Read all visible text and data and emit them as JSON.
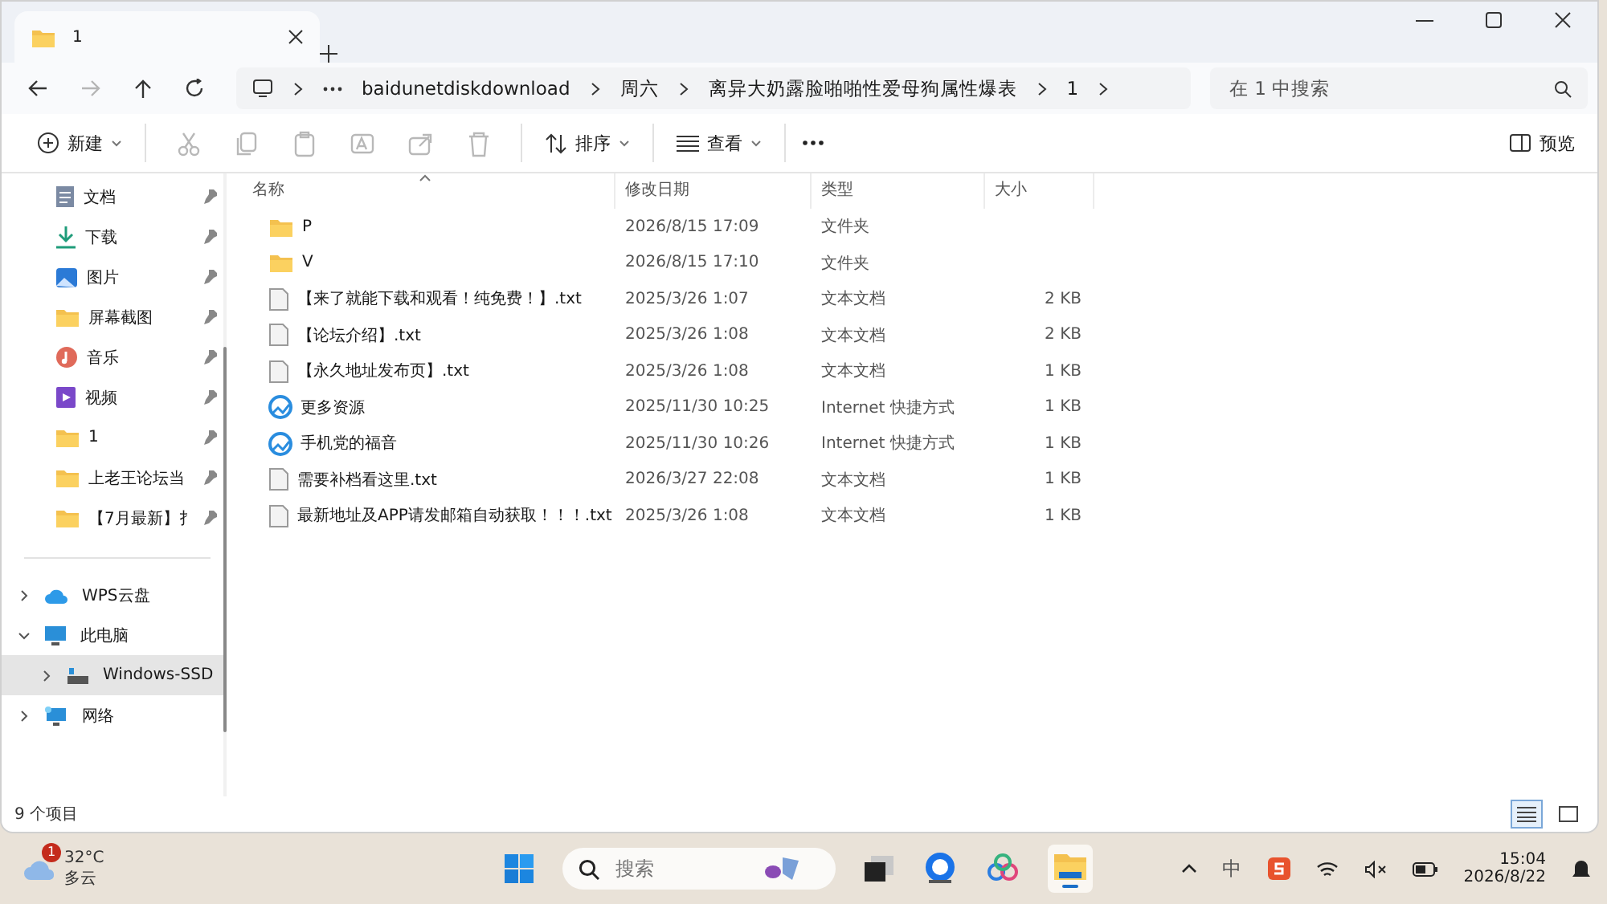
{
  "tab": {
    "title": "1"
  },
  "breadcrumbs": [
    "baidunetdiskdownload",
    "周六",
    "离异大奶露脸啪啪性爱母狗属性爆表",
    "1"
  ],
  "search": {
    "placeholder": "在 1 中搜索"
  },
  "toolbar": {
    "new": "新建",
    "actions": [
      {
        "kind": "cut",
        "disabled": true
      },
      {
        "kind": "copy",
        "disabled": true
      },
      {
        "kind": "paste",
        "disabled": true
      },
      {
        "kind": "rename",
        "disabled": true
      },
      {
        "kind": "share",
        "disabled": true
      },
      {
        "kind": "delete",
        "disabled": true
      }
    ],
    "sort": "排序",
    "view": "查看",
    "preview": "预览"
  },
  "quick_access": [
    {
      "label": "文档",
      "kind": "docs",
      "pinned": true
    },
    {
      "label": "下载",
      "kind": "download",
      "pinned": true
    },
    {
      "label": "图片",
      "kind": "pictures",
      "pinned": true
    },
    {
      "label": "屏幕截图",
      "kind": "folder",
      "pinned": true
    },
    {
      "label": "音乐",
      "kind": "music",
      "pinned": true
    },
    {
      "label": "视频",
      "kind": "video",
      "pinned": true
    },
    {
      "label": "1",
      "kind": "folder",
      "pinned": true
    },
    {
      "label": "上老王论坛当",
      "kind": "folder",
      "pinned": true
    },
    {
      "label": "【7月最新】扌",
      "kind": "folder",
      "pinned": true
    }
  ],
  "locations": [
    {
      "label": "WPS云盘",
      "kind": "cloud",
      "expanded": false,
      "selected": false
    },
    {
      "label": "此电脑",
      "kind": "pc",
      "expanded": true,
      "selected": false,
      "children": [
        {
          "label": "Windows-SSD",
          "kind": "drive",
          "expanded": false,
          "selected": true
        }
      ]
    },
    {
      "label": "网络",
      "kind": "network",
      "expanded": false,
      "selected": false
    }
  ],
  "columns": [
    "名称",
    "修改日期",
    "类型",
    "大小"
  ],
  "rows": [
    {
      "kind": "folder",
      "name": "P",
      "date": "2026/8/15 17:09",
      "type": "文件夹"
    },
    {
      "kind": "folder",
      "name": "V",
      "date": "2026/8/15 17:10",
      "type": "文件夹"
    },
    {
      "kind": "text",
      "name": "【来了就能下载和观看！纯免费！】.txt",
      "date": "2025/3/26 1:07",
      "type": "文本文档",
      "size": "2 KB"
    },
    {
      "kind": "text",
      "name": "【论坛介绍】.txt",
      "date": "2025/3/26 1:08",
      "type": "文本文档",
      "size": "2 KB"
    },
    {
      "kind": "text",
      "name": "【永久地址发布页】.txt",
      "date": "2025/3/26 1:08",
      "type": "文本文档",
      "size": "1 KB"
    },
    {
      "kind": "link",
      "name": "更多资源",
      "date": "2025/11/30 10:25",
      "type": "Internet 快捷方式",
      "size": "1 KB"
    },
    {
      "kind": "link",
      "name": "手机党的福音",
      "date": "2025/11/30 10:26",
      "type": "Internet 快捷方式",
      "size": "1 KB"
    },
    {
      "kind": "text",
      "name": "需要补档看这里.txt",
      "date": "2026/3/27 22:08",
      "type": "文本文档",
      "size": "1 KB"
    },
    {
      "kind": "text",
      "name": "最新地址及APP请发邮箱自动获取！！！.txt",
      "date": "2025/3/26 1:08",
      "type": "文本文档",
      "size": "1 KB"
    }
  ],
  "status": "9 个项目",
  "view_modes": [
    {
      "kind": "details",
      "selected": true
    },
    {
      "kind": "tiles",
      "selected": false
    }
  ],
  "taskbar": {
    "weather": {
      "badge": "1",
      "temp": "32°C",
      "condition": "多云"
    },
    "search_placeholder": "搜索",
    "ime": "中",
    "time": "15:04",
    "date": "2026/8/22"
  }
}
